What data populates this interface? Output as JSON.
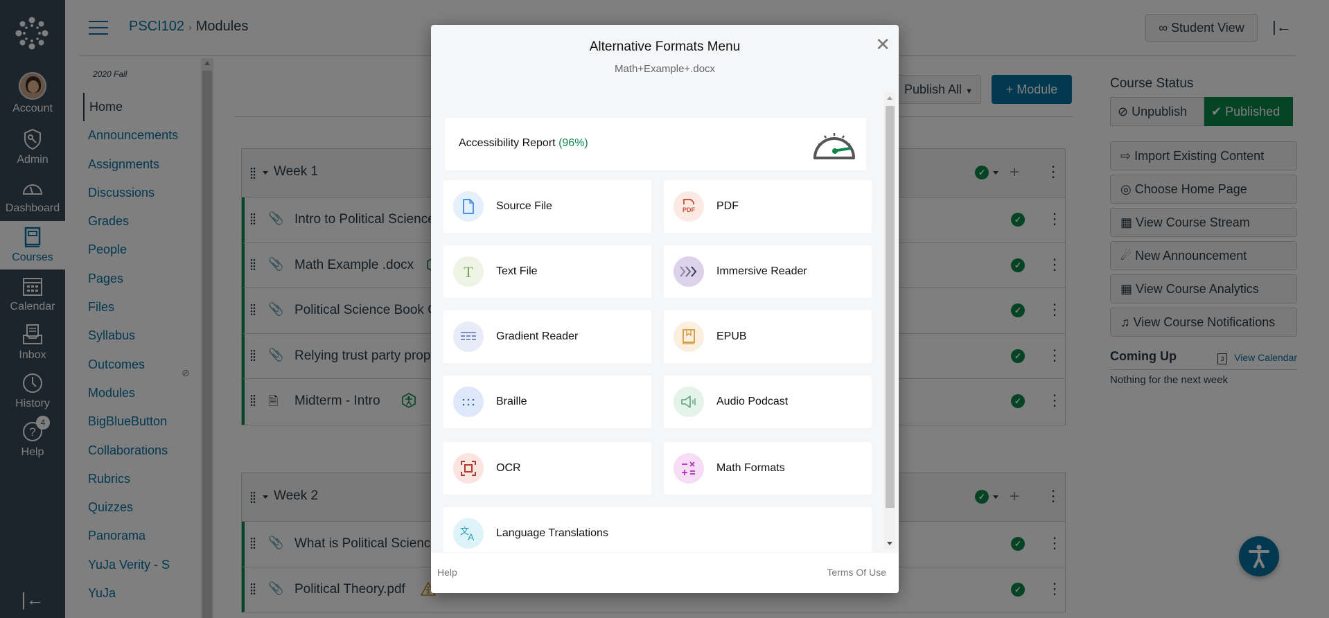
{
  "global_nav": {
    "items": [
      {
        "label": "Account",
        "icon": "avatar"
      },
      {
        "label": "Admin",
        "icon": "shield-key-icon"
      },
      {
        "label": "Dashboard",
        "icon": "speedometer-icon"
      },
      {
        "label": "Courses",
        "icon": "book-icon",
        "active": true
      },
      {
        "label": "Calendar",
        "icon": "calendar-icon"
      },
      {
        "label": "Inbox",
        "icon": "inbox-icon"
      },
      {
        "label": "History",
        "icon": "clock-icon"
      },
      {
        "label": "Help",
        "icon": "help-icon",
        "badge": "4"
      }
    ]
  },
  "header": {
    "breadcrumb_course": "PSCI102",
    "breadcrumb_page": "Modules",
    "student_view": "Student View"
  },
  "course_nav": {
    "term": "2020 Fall",
    "items": [
      {
        "label": "Home",
        "active": true
      },
      {
        "label": "Announcements"
      },
      {
        "label": "Assignments"
      },
      {
        "label": "Discussions"
      },
      {
        "label": "Grades"
      },
      {
        "label": "People"
      },
      {
        "label": "Pages"
      },
      {
        "label": "Files"
      },
      {
        "label": "Syllabus"
      },
      {
        "label": "Outcomes",
        "hidden_icon": true
      },
      {
        "label": "Modules"
      },
      {
        "label": "BigBlueButton"
      },
      {
        "label": "Collaborations"
      },
      {
        "label": "Rubrics"
      },
      {
        "label": "Quizzes"
      },
      {
        "label": "Panorama"
      },
      {
        "label": "YuJa Verity - S"
      },
      {
        "label": "YuJa"
      }
    ]
  },
  "toolbar": {
    "publish_all": "Publish All",
    "add_module": "+ Module"
  },
  "modules": [
    {
      "title": "Week 1",
      "items": [
        {
          "name": "Intro to Political Science",
          "type": "attachment"
        },
        {
          "name": "Math Example .docx",
          "type": "attachment",
          "a11y": "good"
        },
        {
          "name": "Political Science Book Ch",
          "type": "attachment"
        },
        {
          "name": "Relying trust party prope",
          "type": "attachment"
        },
        {
          "name": "Midterm - Intro",
          "type": "page",
          "a11y": "good"
        }
      ]
    },
    {
      "title": "Week 2",
      "items": [
        {
          "name": "What is Political Science.",
          "type": "attachment"
        },
        {
          "name": "Political Theory.pdf",
          "type": "attachment",
          "a11y": "warning"
        }
      ]
    }
  ],
  "right_sidebar": {
    "course_status_heading": "Course Status",
    "unpublish": "Unpublish",
    "published": "Published",
    "buttons": [
      {
        "label": "Import Existing Content",
        "icon": "import-icon"
      },
      {
        "label": "Choose Home Page",
        "icon": "target-icon"
      },
      {
        "label": "View Course Stream",
        "icon": "bar-chart-icon"
      },
      {
        "label": "New Announcement",
        "icon": "megaphone-icon"
      },
      {
        "label": "View Course Analytics",
        "icon": "bar-chart-icon"
      },
      {
        "label": "View Course Notifications",
        "icon": "bell-icon"
      }
    ],
    "coming_up": "Coming Up",
    "view_calendar": "View Calendar",
    "calendar_day": "3",
    "nothing": "Nothing for the next week"
  },
  "modal": {
    "title": "Alternative Formats Menu",
    "subtitle": "Math+Example+.docx",
    "report_label": "Accessibility Report",
    "report_score": "(96%)",
    "report_score_value": 96,
    "formats": [
      {
        "label": "Source File",
        "icon": "file-icon",
        "color": "#4a90e2",
        "bg": "#e4f0fb"
      },
      {
        "label": "PDF",
        "icon": "pdf-icon",
        "color": "#d0553a",
        "bg": "#fbe9e4"
      },
      {
        "label": "Text File",
        "icon": "text-t-icon",
        "color": "#7aa04a",
        "bg": "#eef3e6"
      },
      {
        "label": "Immersive Reader",
        "icon": "immersive-reader-icon",
        "color": "#3b3b5c",
        "bg": "#dcd3ea"
      },
      {
        "label": "Gradient Reader",
        "icon": "gradient-lines-icon",
        "color": "#5c6fc0",
        "bg": "#e8ecf6"
      },
      {
        "label": "EPUB",
        "icon": "book-bookmark-icon",
        "color": "#d9a04a",
        "bg": "#fbf0e0"
      },
      {
        "label": "Braille",
        "icon": "braille-dots-icon",
        "color": "#3b5fa8",
        "bg": "#dde8fa"
      },
      {
        "label": "Audio Podcast",
        "icon": "speaker-icon",
        "color": "#5aa27a",
        "bg": "#e4f4ea"
      },
      {
        "label": "OCR",
        "icon": "scan-frame-icon",
        "color": "#b03a2e",
        "bg": "#fbe3e0"
      },
      {
        "label": "Math Formats",
        "icon": "math-symbols-icon",
        "color": "#b030b8",
        "bg": "#f7dcf6"
      },
      {
        "label": "Language Translations",
        "icon": "translate-icon",
        "color": "#2a9ab0",
        "bg": "#dcf4f8"
      }
    ],
    "footer_help": "Help",
    "footer_terms": "Terms Of Use"
  }
}
